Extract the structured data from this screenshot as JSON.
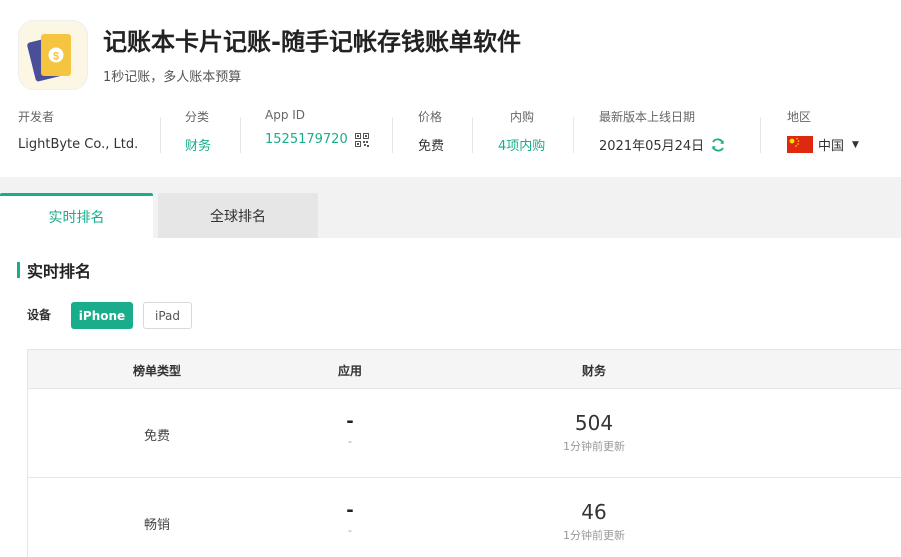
{
  "app": {
    "title": "记账本卡片记账-随手记帐存钱账单软件",
    "subtitle": "1秒记账，多人账本预算",
    "icon": "wallet-card-icon"
  },
  "meta": {
    "developer_label": "开发者",
    "developer": "LightByte Co., Ltd.",
    "category_label": "分类",
    "category": "财务",
    "appid_label": "App ID",
    "appid": "1525179720",
    "price_label": "价格",
    "price": "免费",
    "iap_label": "内购",
    "iap": "4项内购",
    "release_label": "最新版本上线日期",
    "release_date": "2021年05月24日",
    "region_label": "地区",
    "region": "中国"
  },
  "tabs": {
    "realtime": "实时排名",
    "global": "全球排名"
  },
  "section": {
    "title": "实时排名",
    "device_label": "设备",
    "device_iphone": "iPhone",
    "device_ipad": "iPad"
  },
  "table": {
    "headers": [
      "榜单类型",
      "应用",
      "财务"
    ],
    "rows": [
      {
        "type": "免费",
        "app_rank": "-",
        "app_sub": "-",
        "cat_rank": "504",
        "cat_sub": "1分钟前更新"
      },
      {
        "type": "畅销",
        "app_rank": "-",
        "app_sub": "-",
        "cat_rank": "46",
        "cat_sub": "1分钟前更新"
      }
    ]
  },
  "colors": {
    "accent": "#1aad8b",
    "flag_red": "#de2910",
    "flag_yellow": "#ffde00"
  }
}
